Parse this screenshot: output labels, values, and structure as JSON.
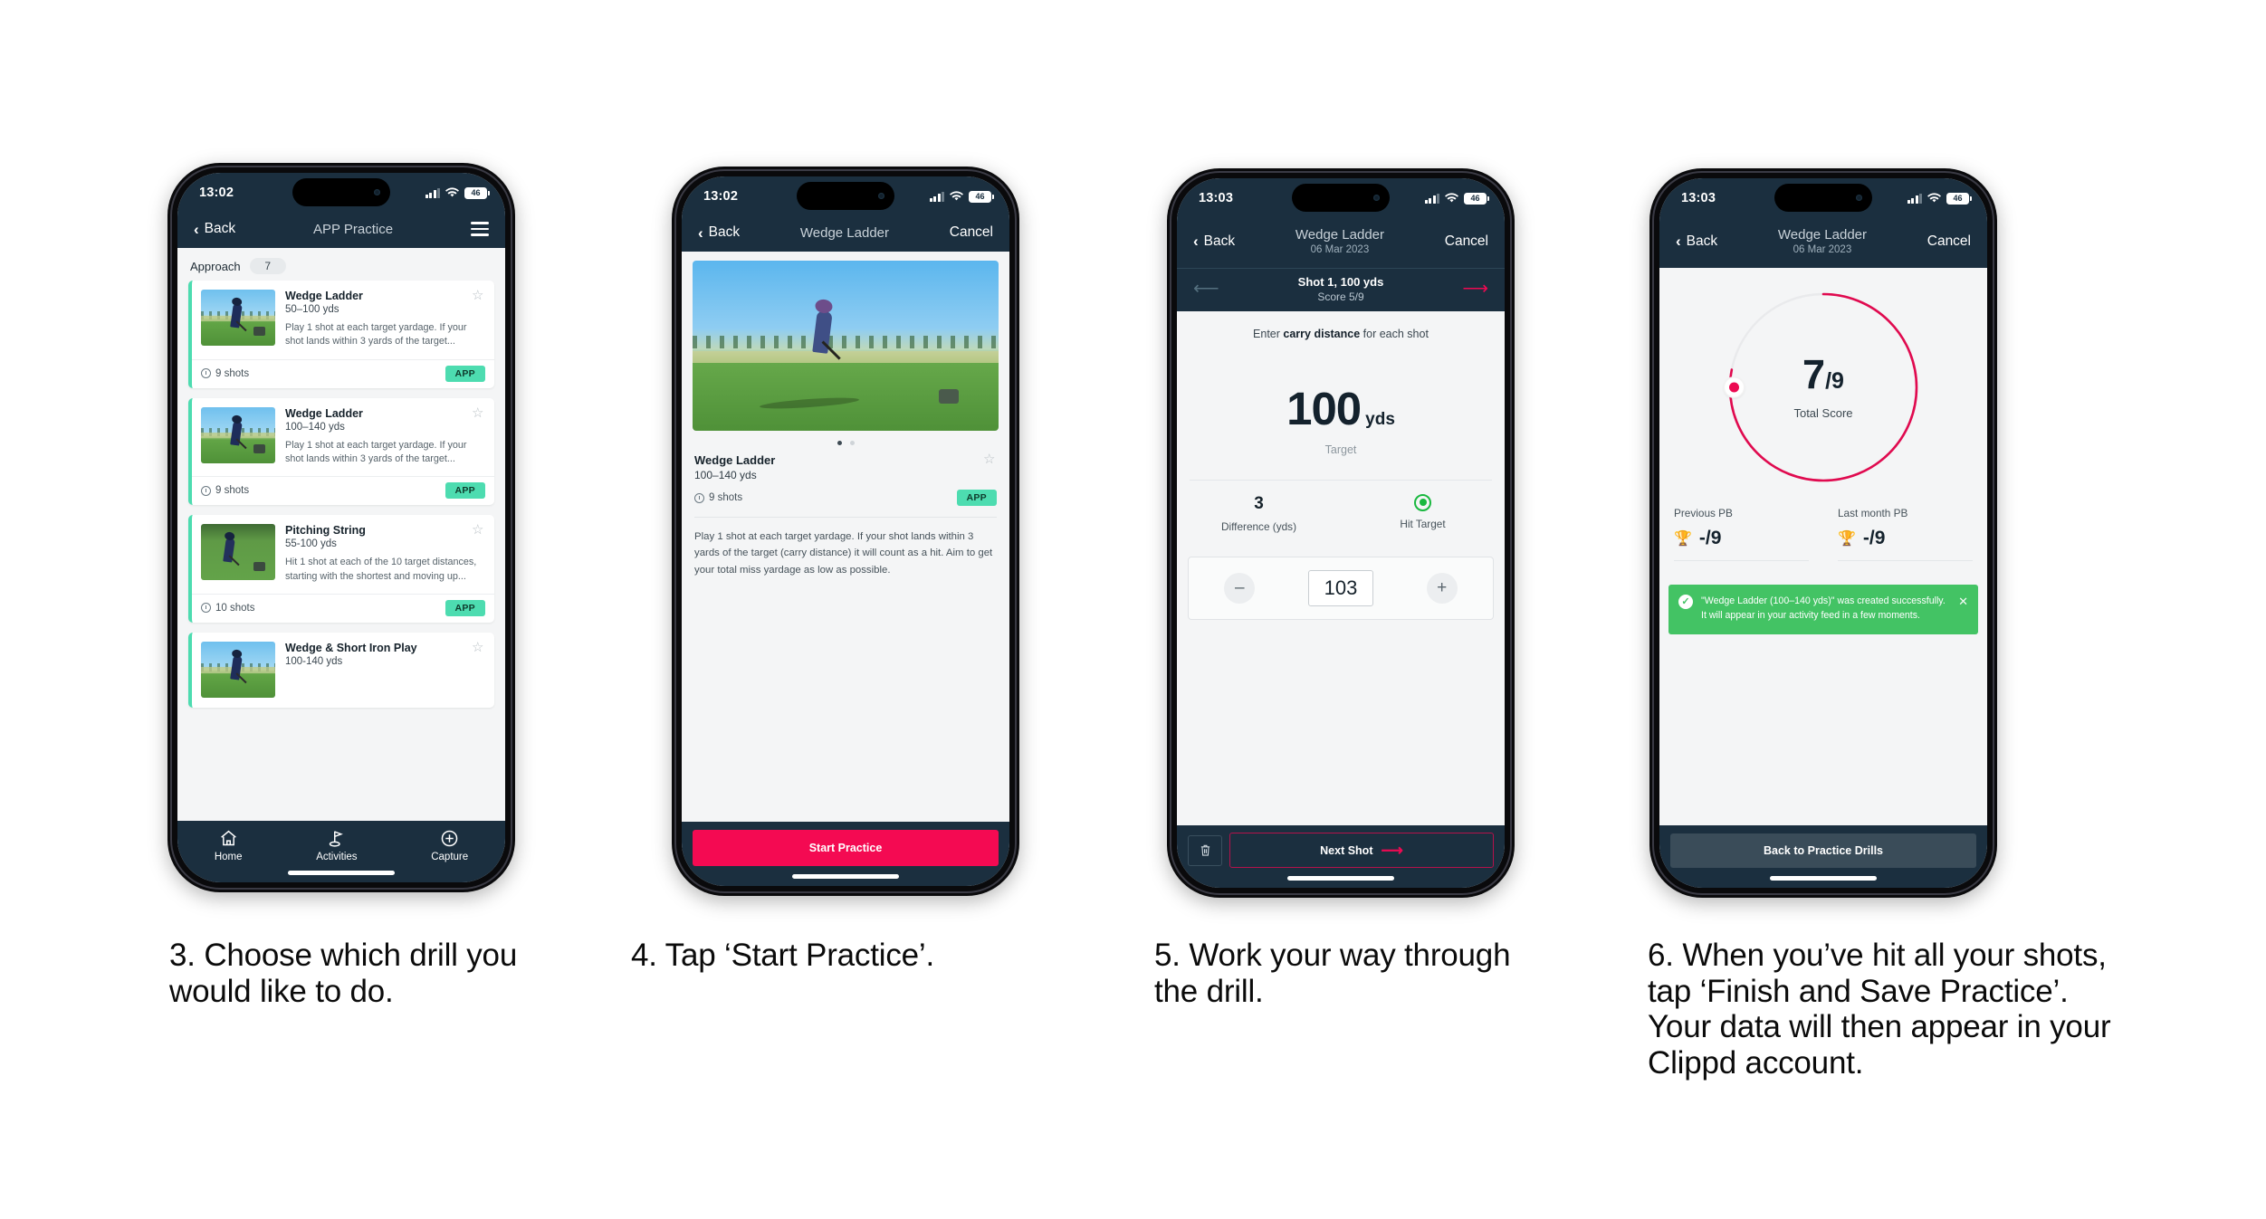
{
  "page": {
    "background": "#ffffff",
    "accent_pink": "#f40a52",
    "accent_teal": "#4ddcb0",
    "header_navy": "#1b2f3f",
    "toast_green": "#43c364"
  },
  "phones": [
    {
      "id": "phone-drill-list",
      "status": {
        "time": "13:02",
        "battery": "46"
      },
      "nav": {
        "back": "Back",
        "title": "APP Practice",
        "menu_icon": "hamburger-icon"
      },
      "section": {
        "title": "Approach",
        "count": "7"
      },
      "cards": [
        {
          "title": "Wedge Ladder",
          "yardage": "50–100 yds",
          "desc": "Play 1 shot at each target yardage. If your shot lands within 3 yards of the target...",
          "shots": "9 shots",
          "badge": "APP"
        },
        {
          "title": "Wedge Ladder",
          "yardage": "100–140 yds",
          "desc": "Play 1 shot at each target yardage. If your shot lands within 3 yards of the target...",
          "shots": "9 shots",
          "badge": "APP"
        },
        {
          "title": "Pitching String",
          "yardage": "55-100 yds",
          "desc": "Hit 1 shot at each of the 10 target distances, starting with the shortest and moving up...",
          "shots": "10 shots",
          "badge": "APP"
        },
        {
          "title": "Wedge & Short Iron Play",
          "yardage": "100-140 yds",
          "desc": "",
          "shots": "",
          "badge": ""
        }
      ],
      "tabs": [
        {
          "label": "Home",
          "icon": "home-icon"
        },
        {
          "label": "Activities",
          "icon": "golf-flag-icon"
        },
        {
          "label": "Capture",
          "icon": "plus-circle-icon"
        }
      ]
    },
    {
      "id": "phone-drill-detail",
      "status": {
        "time": "13:02",
        "battery": "46"
      },
      "nav": {
        "back": "Back",
        "title": "Wedge Ladder",
        "cancel": "Cancel"
      },
      "carousel": {
        "dots": 2,
        "active": 0
      },
      "detail": {
        "title": "Wedge Ladder",
        "yardage": "100–140 yds",
        "shots": "9 shots",
        "badge": "APP",
        "description": "Play 1 shot at each target yardage. If your shot lands within 3 yards of the target (carry distance) it will count as a hit. Aim to get your total miss yardage as low as possible."
      },
      "cta": "Start Practice"
    },
    {
      "id": "phone-shot-entry",
      "status": {
        "time": "13:03",
        "battery": "46"
      },
      "nav": {
        "back": "Back",
        "title": "Wedge Ladder",
        "subtitle": "06 Mar 2023",
        "cancel": "Cancel"
      },
      "shotbar": {
        "title": "Shot 1, 100 yds",
        "score": "Score 5/9",
        "prev_icon": "arrow-left-icon",
        "next_icon": "arrow-right-icon"
      },
      "hint_prefix": "Enter ",
      "hint_bold": "carry distance",
      "hint_suffix": " for each shot",
      "target": {
        "value": "100",
        "unit": "yds",
        "label": "Target"
      },
      "stats": [
        {
          "value": "3",
          "label": "Difference (yds)"
        },
        {
          "value": "",
          "label": "Hit Target",
          "icon": "target-dot-icon"
        }
      ],
      "stepper": {
        "minus": "–",
        "value": "103",
        "plus": "+"
      },
      "footer": {
        "delete_icon": "trash-icon",
        "next": "Next Shot"
      }
    },
    {
      "id": "phone-summary",
      "status": {
        "time": "13:03",
        "battery": "46"
      },
      "nav": {
        "back": "Back",
        "title": "Wedge Ladder",
        "subtitle": "06 Mar 2023",
        "cancel": "Cancel"
      },
      "ring": {
        "score": "7",
        "separator": "/",
        "denominator": "9",
        "caption": "Total Score",
        "percent": 78
      },
      "pbs": [
        {
          "label": "Previous PB",
          "icon": "trophy-icon",
          "value": "-/9"
        },
        {
          "label": "Last month PB",
          "icon": "trophy-icon",
          "value": "-/9"
        }
      ],
      "toast": {
        "icon": "check-circle-icon",
        "message": "\"Wedge Ladder (100–140 yds)\" was created successfully. It will appear in your activity feed in a few moments.",
        "close_icon": "close-icon"
      },
      "footer_button": "Back to Practice Drills"
    }
  ],
  "captions": [
    {
      "text": "3. Choose which drill you would like to do."
    },
    {
      "text": "4. Tap ‘Start Practice’."
    },
    {
      "text": "5. Work your way through the drill."
    },
    {
      "text": "6. When you’ve hit all your shots, tap ‘Finish and Save Practice’. Your data will then appear in your Clippd account."
    }
  ]
}
